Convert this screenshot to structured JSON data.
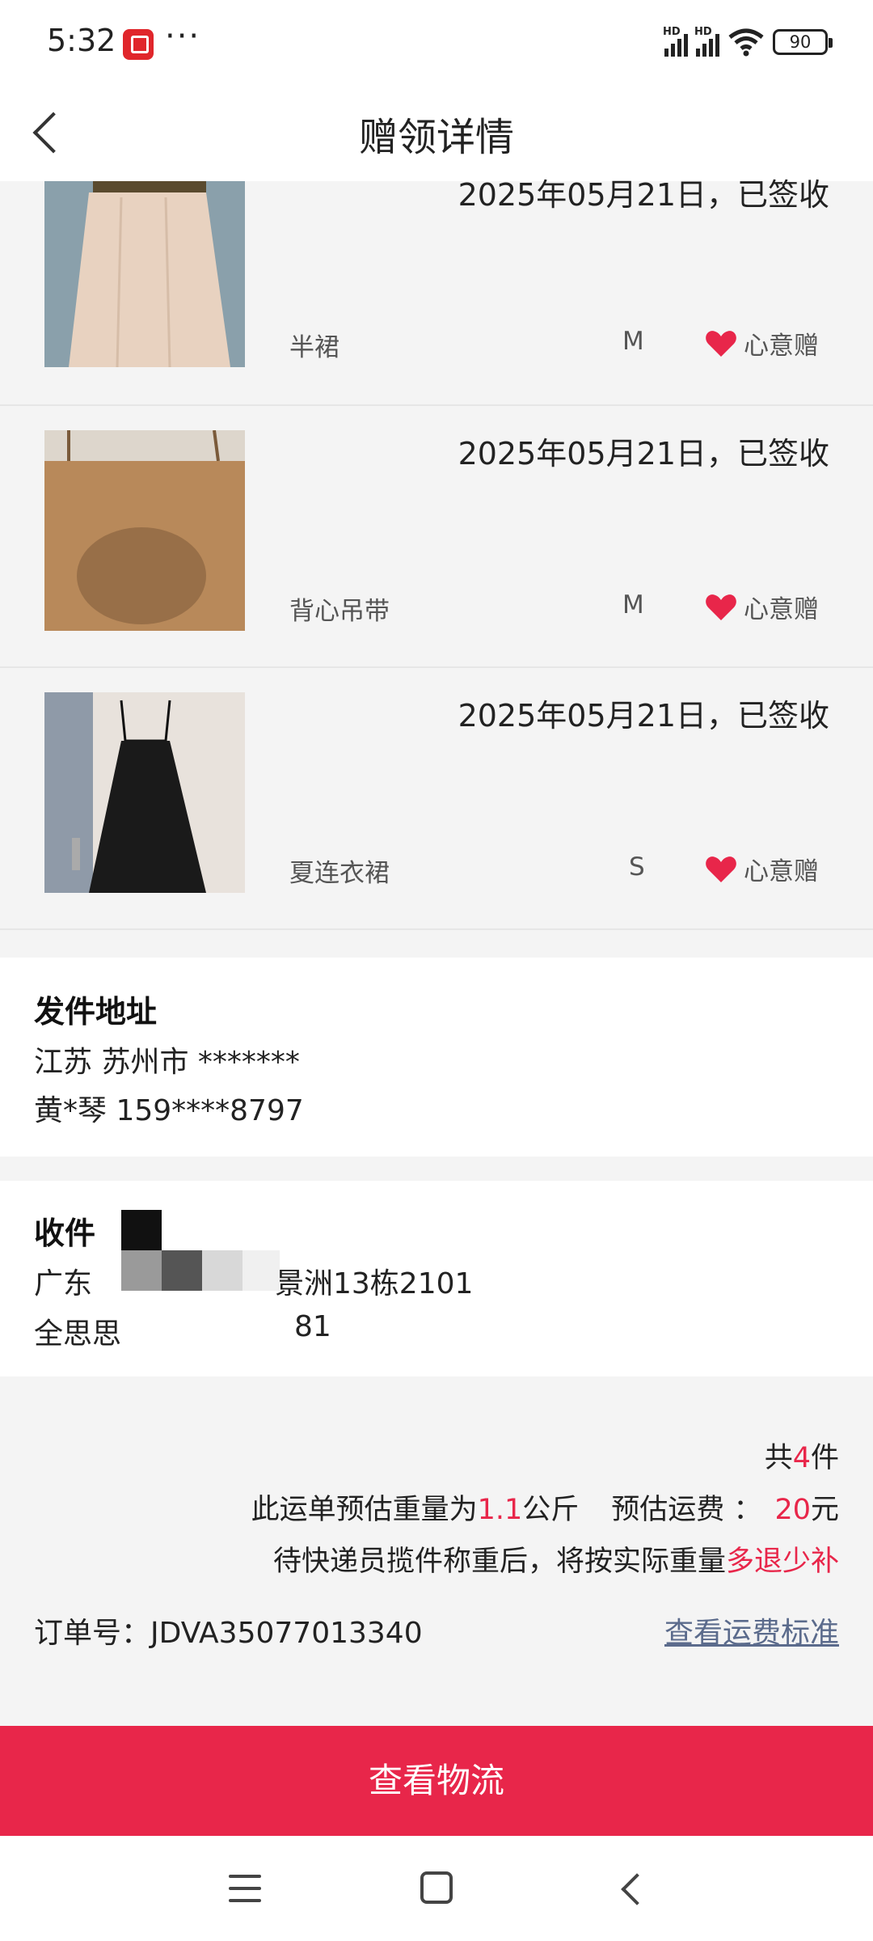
{
  "status_bar": {
    "time": "5:32",
    "more": "···",
    "signal1_label": "HD",
    "signal2_label": "HD",
    "battery": "90",
    "icons": [
      "app-notification-icon",
      "signal-icon",
      "signal-icon",
      "wifi-icon",
      "battery-icon"
    ]
  },
  "header": {
    "title": "赠领详情"
  },
  "items": [
    {
      "date": "2025年05月21日，已签收",
      "name": "半裙",
      "size": "M",
      "tag": "心意赠"
    },
    {
      "date": "2025年05月21日，已签收",
      "name": "背心吊带",
      "size": "M",
      "tag": "心意赠"
    },
    {
      "date": "2025年05月21日，已签收",
      "name": "夏连衣裙",
      "size": "S",
      "tag": "心意赠"
    }
  ],
  "sender": {
    "title": "发件地址",
    "address": "江苏 苏州市 *******",
    "contact": "黄*琴 159****8797"
  },
  "receiver": {
    "title": "收件",
    "address_prefix": "广东",
    "address_suffix": "景洲13栋2101",
    "name": "全思思",
    "phone_end": "81"
  },
  "summary": {
    "count_prefix": "共",
    "count": "4",
    "count_suffix": "件",
    "weight_prefix": "此运单预估重量为",
    "weight": "1.1",
    "weight_unit": "公斤",
    "fee_prefix": "预估运费 ：",
    "fee": "20",
    "fee_unit": "元",
    "note_prefix": "待快递员揽件称重后，将按实际重量",
    "note_highlight": "多退少补",
    "order_label": "订单号：",
    "order_no": "JDVA35077013340",
    "fee_standard_link": "查看运费标准"
  },
  "action_button": "查看物流",
  "colors": {
    "accent": "#e8264a",
    "link": "#5b6b8c"
  }
}
